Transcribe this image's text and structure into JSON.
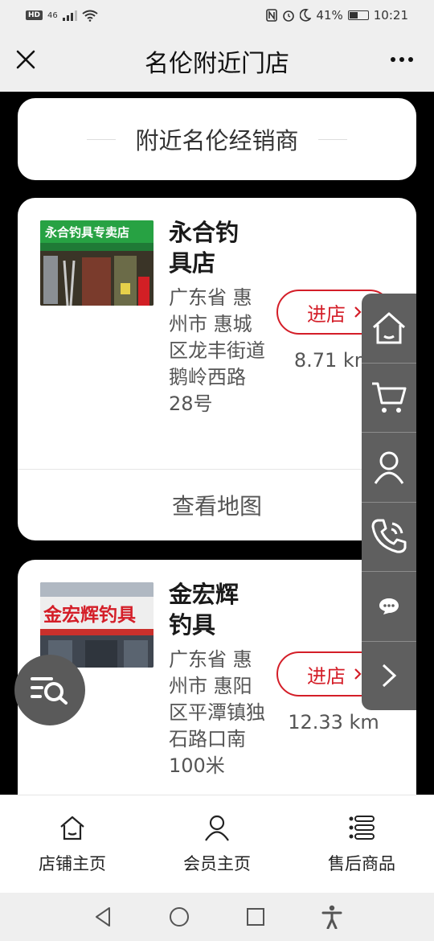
{
  "status_bar": {
    "hd": "HD",
    "signal": "46",
    "battery": "41%",
    "time": "10:21"
  },
  "header": {
    "title": "名伦附近门店"
  },
  "section": {
    "title": "附近名伦经销商"
  },
  "stores": [
    {
      "name": "永合钓具店",
      "address": "广东省 惠州市 惠城区龙丰街道鹅岭西路28号",
      "enter_label": "进店",
      "distance": "8.71 km",
      "map_label": "查看地图",
      "sign_text": "永合钓具专卖店"
    },
    {
      "name": "金宏辉钓具",
      "address": "广东省 惠州市 惠阳区平潭镇独石路口南100米",
      "enter_label": "进店",
      "distance": "12.33 km",
      "sign_text": "金宏辉钓具"
    }
  ],
  "side_menu": [
    "home-icon",
    "cart-icon",
    "user-icon",
    "phone-icon",
    "chat-icon",
    "chevron-right-icon"
  ],
  "bottom_tabs": [
    {
      "label": "店铺主页",
      "icon": "home-icon"
    },
    {
      "label": "会员主页",
      "icon": "user-icon"
    },
    {
      "label": "售后商品",
      "icon": "list-icon"
    }
  ],
  "colors": {
    "accent": "#d41e28",
    "side_bar": "#5f5f5f",
    "background": "#000000"
  }
}
